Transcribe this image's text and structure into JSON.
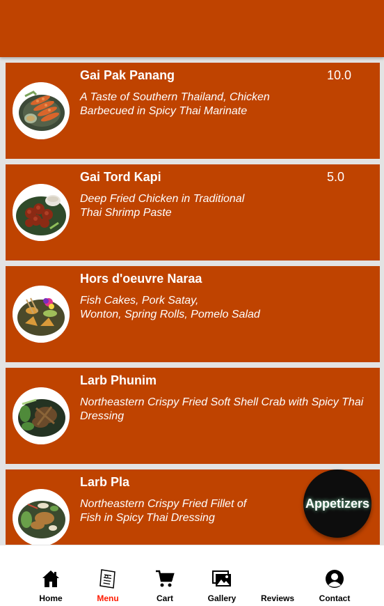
{
  "theme": {
    "primary": "#bf4300",
    "background": "#e3e3e3",
    "active_nav": "#ff1a00",
    "fab": "#0d0d0d"
  },
  "menu_items": [
    {
      "name": "Gai Pak Panang",
      "price": "10.0",
      "description": "A Taste of Southern Thailand, Chicken\nBarbecued in Spicy Thai Marinate",
      "image": "chicken-skewers-photo"
    },
    {
      "name": "Gai Tord Kapi",
      "price": "5.0",
      "description": "Deep Fried Chicken in Traditional\nThai Shrimp Paste",
      "image": "fried-chicken-photo"
    },
    {
      "name": "Hors d'oeuvre Naraa",
      "price": "",
      "description": "Fish Cakes, Pork Satay,\nWonton, Spring Rolls, Pomelo Salad",
      "image": "appetizer-platter-photo"
    },
    {
      "name": "Larb Phunim",
      "price": "",
      "description": "Northeastern Crispy Fried Soft Shell Crab with Spicy Thai\nDressing",
      "image": "soft-shell-crab-photo"
    },
    {
      "name": "Larb Pla",
      "price": "",
      "description": "Northeastern Crispy Fried Fillet of\nFish in Spicy Thai Dressing",
      "image": "fish-salad-photo"
    }
  ],
  "category_button": {
    "label": "Appetizers"
  },
  "bottom_nav": {
    "active": "Menu",
    "items": [
      {
        "label": "Home",
        "icon": "home-icon"
      },
      {
        "label": "Menu",
        "icon": "menu-book-icon"
      },
      {
        "label": "Cart",
        "icon": "cart-icon"
      },
      {
        "label": "Gallery",
        "icon": "gallery-icon"
      },
      {
        "label": "Reviews",
        "icon": "reviews-icon"
      },
      {
        "label": "Contact",
        "icon": "contact-icon"
      }
    ]
  }
}
